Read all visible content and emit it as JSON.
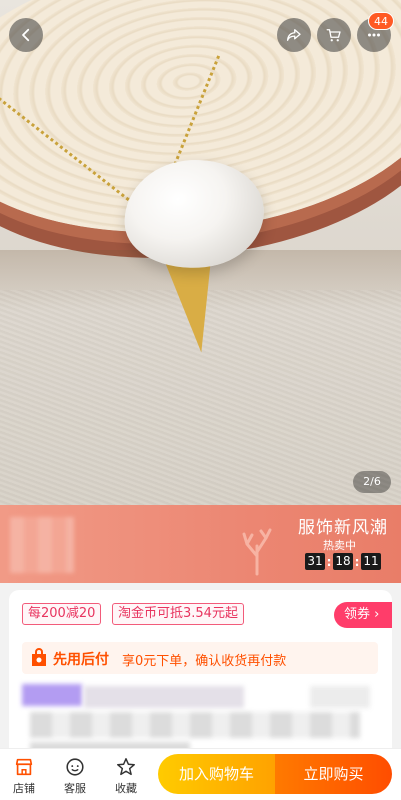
{
  "header": {
    "cart_badge": "44"
  },
  "gallery": {
    "counter": "2/6"
  },
  "promo": {
    "title": "服饰新风潮",
    "subtitle": "热卖中",
    "timer": [
      "31",
      "18",
      "11"
    ]
  },
  "offers": {
    "tag1": "每200减20",
    "tag2": "淘金币可抵3.54元起",
    "coupon_button": "领券 ›"
  },
  "pay_later": {
    "title": "先用后付",
    "desc": "享0元下单，确认收货再付款"
  },
  "bottom_bar": {
    "shop": "店铺",
    "service": "客服",
    "favorite": "收藏",
    "add_to_cart": "加入购物车",
    "buy_now": "立即购买"
  },
  "colors": {
    "accent_orange": "#ff5000",
    "cart_yellow": "#ffb800",
    "coupon_pink": "#ff3d6a",
    "promo_coral": "#ec8773"
  },
  "icons": [
    "back-arrow-icon",
    "share-icon",
    "cart-icon",
    "more-icon",
    "shop-icon",
    "service-icon",
    "star-icon",
    "pay-later-icon"
  ]
}
